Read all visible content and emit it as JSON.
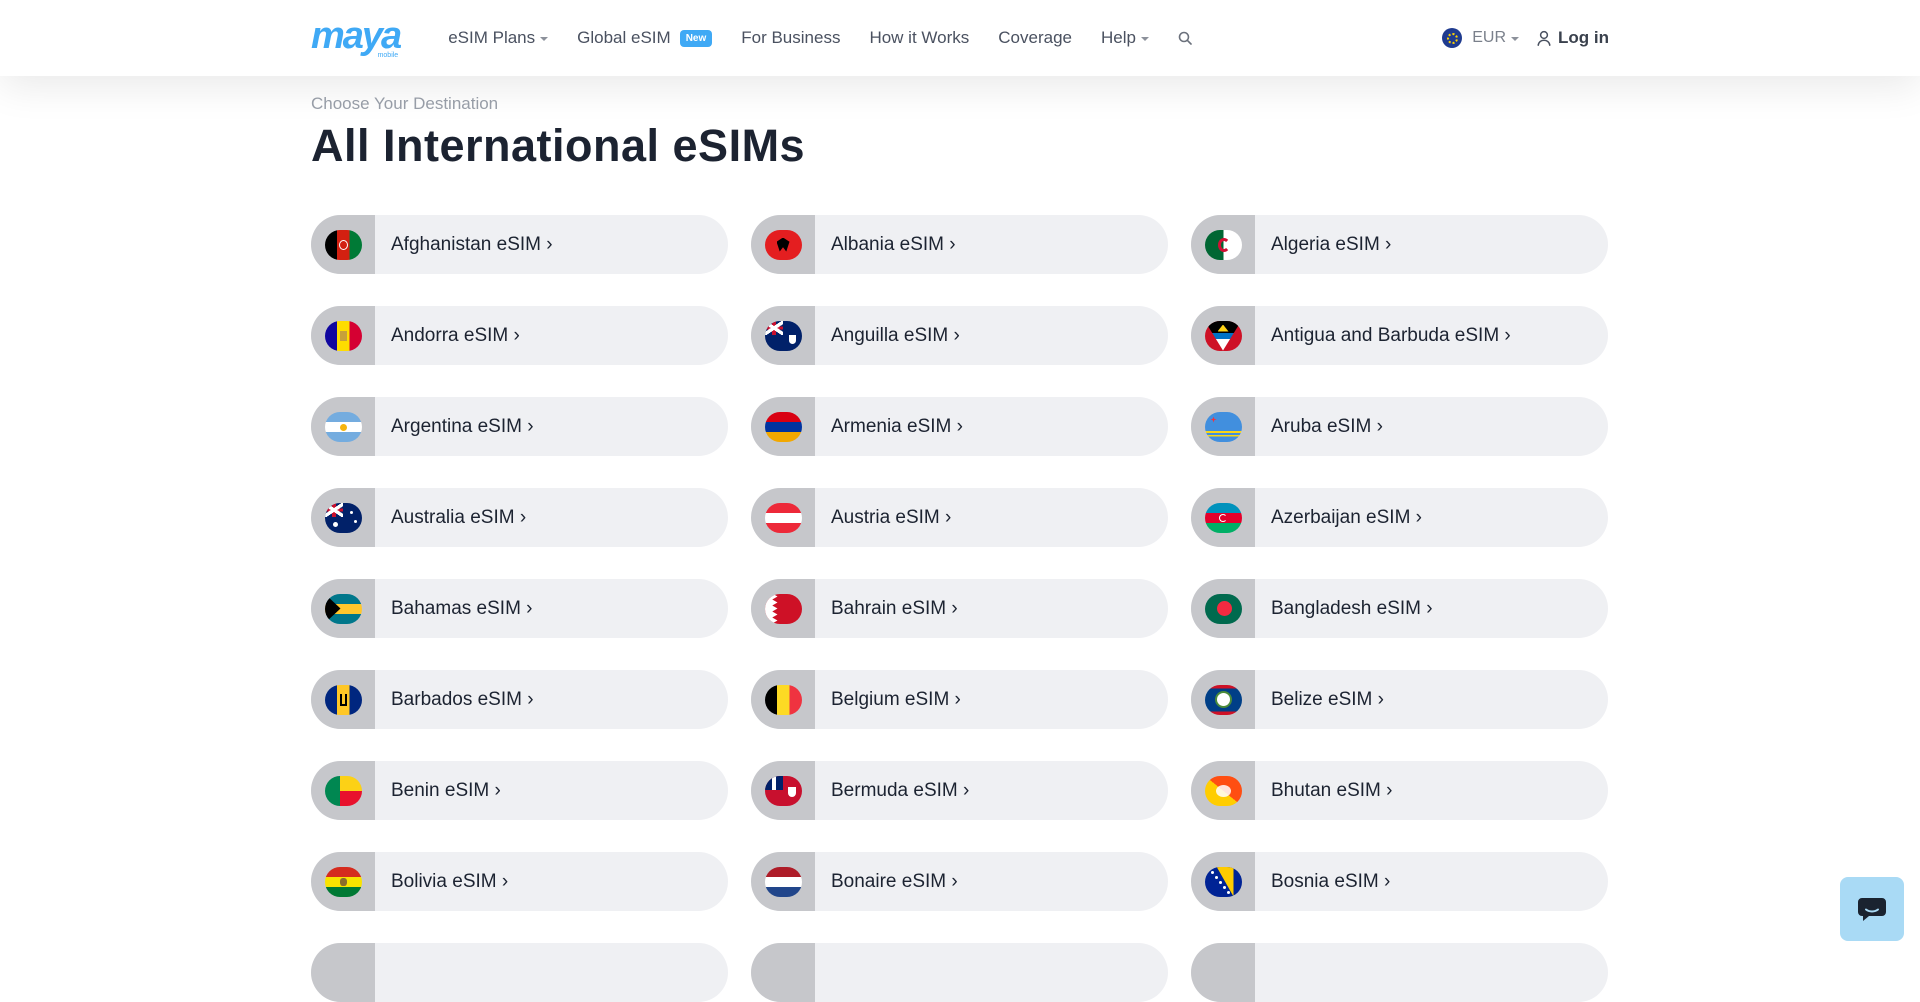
{
  "header": {
    "logo_text": "maya",
    "logo_sub": "mobile",
    "nav": [
      {
        "label": "eSIM Plans",
        "has_caret": true
      },
      {
        "label": "Global eSIM",
        "badge": "New"
      },
      {
        "label": "For Business"
      },
      {
        "label": "How it Works"
      },
      {
        "label": "Coverage"
      },
      {
        "label": "Help",
        "has_caret": true
      }
    ],
    "currency": "EUR",
    "login": "Log in"
  },
  "main": {
    "breadcrumb": "Choose Your Destination",
    "title": "All International eSIMs",
    "countries": [
      {
        "label": "Afghanistan eSIM ›",
        "icon": "flag-afghanistan-icon"
      },
      {
        "label": "Albania eSIM ›",
        "icon": "flag-albania-icon"
      },
      {
        "label": "Algeria eSIM ›",
        "icon": "flag-algeria-icon"
      },
      {
        "label": "Andorra eSIM ›",
        "icon": "flag-andorra-icon"
      },
      {
        "label": "Anguilla eSIM ›",
        "icon": "flag-anguilla-icon"
      },
      {
        "label": "Antigua and Barbuda eSIM ›",
        "icon": "flag-antigua-icon"
      },
      {
        "label": "Argentina eSIM ›",
        "icon": "flag-argentina-icon"
      },
      {
        "label": "Armenia eSIM ›",
        "icon": "flag-armenia-icon"
      },
      {
        "label": "Aruba eSIM ›",
        "icon": "flag-aruba-icon"
      },
      {
        "label": "Australia eSIM ›",
        "icon": "flag-australia-icon"
      },
      {
        "label": "Austria eSIM ›",
        "icon": "flag-austria-icon"
      },
      {
        "label": "Azerbaijan eSIM ›",
        "icon": "flag-azerbaijan-icon"
      },
      {
        "label": "Bahamas eSIM ›",
        "icon": "flag-bahamas-icon"
      },
      {
        "label": "Bahrain eSIM ›",
        "icon": "flag-bahrain-icon"
      },
      {
        "label": "Bangladesh eSIM ›",
        "icon": "flag-bangladesh-icon"
      },
      {
        "label": "Barbados eSIM ›",
        "icon": "flag-barbados-icon"
      },
      {
        "label": "Belgium eSIM ›",
        "icon": "flag-belgium-icon"
      },
      {
        "label": "Belize eSIM ›",
        "icon": "flag-belize-icon"
      },
      {
        "label": "Benin eSIM ›",
        "icon": "flag-benin-icon"
      },
      {
        "label": "Bermuda eSIM ›",
        "icon": "flag-bermuda-icon"
      },
      {
        "label": "Bhutan eSIM ›",
        "icon": "flag-bhutan-icon"
      },
      {
        "label": "Bolivia eSIM ›",
        "icon": "flag-bolivia-icon"
      },
      {
        "label": "Bonaire eSIM ›",
        "icon": "flag-bonaire-icon"
      },
      {
        "label": "Bosnia eSIM ›",
        "icon": "flag-bosnia-icon"
      }
    ]
  },
  "colors": {
    "accent": "#3fa9f5",
    "card_bg": "#eff0f3",
    "flag_bg": "#c6c7cb",
    "text": "#1c2331"
  }
}
